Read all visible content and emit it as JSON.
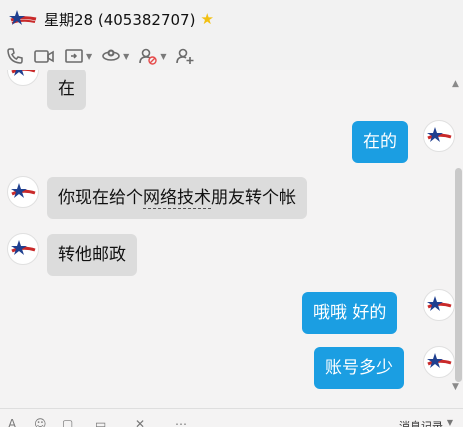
{
  "header": {
    "title": "星期28 (405382707)",
    "star_icon": "star-icon",
    "star_color": "#f2c011"
  },
  "toolbar": {
    "items": [
      {
        "icon": "phone-icon"
      },
      {
        "icon": "video-icon"
      },
      {
        "icon": "screen-share-icon"
      },
      {
        "icon": "remote-assist-icon"
      },
      {
        "icon": "block-user-icon"
      },
      {
        "icon": "add-friend-icon"
      }
    ]
  },
  "messages": [
    {
      "side": "in",
      "text": "在"
    },
    {
      "side": "out",
      "text": "在的"
    },
    {
      "side": "in",
      "parts": [
        "你现在给个",
        "网络技术",
        "朋友转个帐"
      ]
    },
    {
      "side": "in",
      "text": "转他邮政"
    },
    {
      "side": "out",
      "text": "哦哦 好的"
    },
    {
      "side": "out",
      "text": "账号多少"
    }
  ],
  "colors": {
    "incoming_bubble": "#dcdcdc",
    "outgoing_bubble": "#1b9ee2",
    "outgoing_text": "#ffffff"
  },
  "footer": {
    "history_label": "消息记录"
  }
}
